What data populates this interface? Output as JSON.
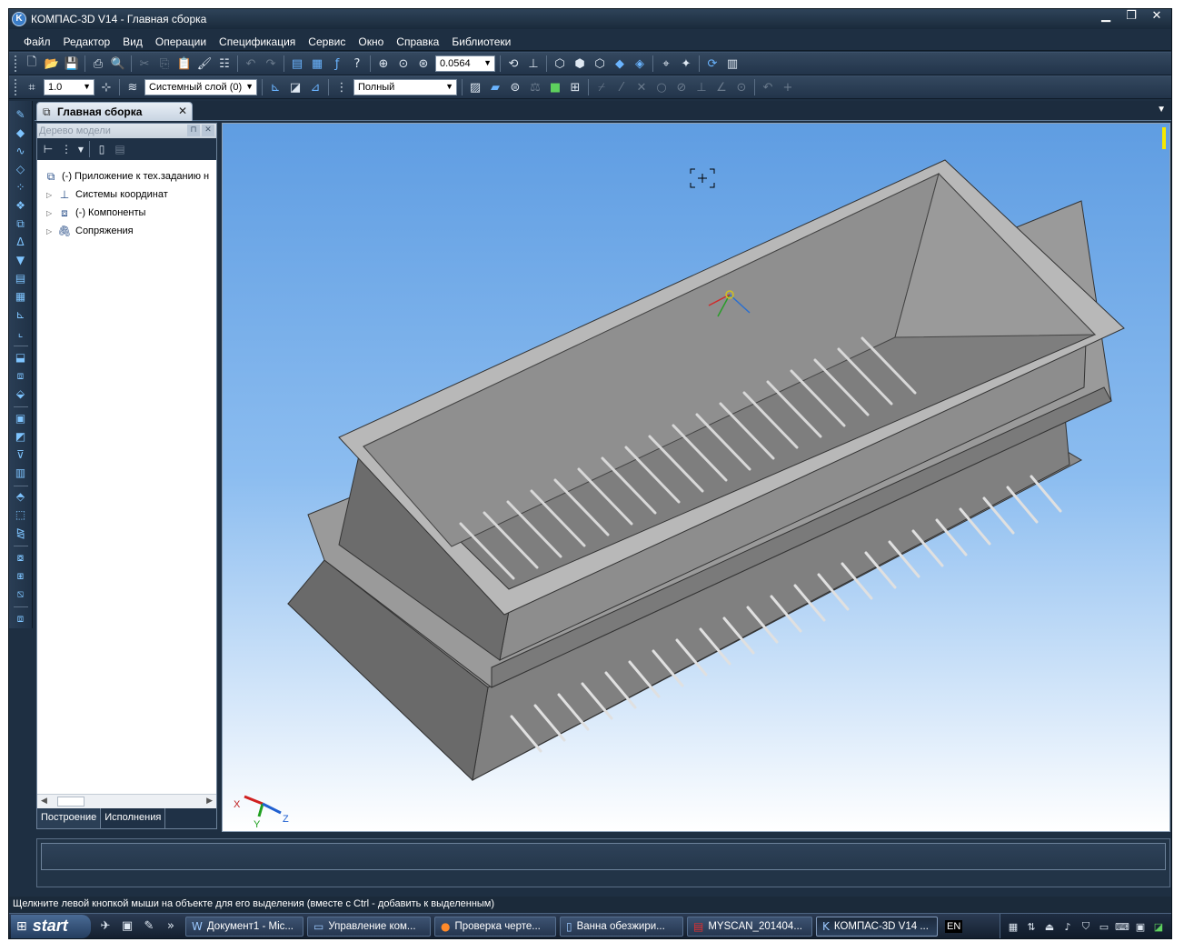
{
  "window": {
    "title": "КОМПАС-3D V14 - Главная сборка",
    "logo_letter": "K",
    "controls": {
      "minimize": "▁",
      "restore": "❐",
      "close": "✕"
    }
  },
  "menu": [
    "Файл",
    "Редактор",
    "Вид",
    "Операции",
    "Спецификация",
    "Сервис",
    "Окно",
    "Справка",
    "Библиотеки"
  ],
  "toolbar_main": {
    "zoom_value": "0.0564"
  },
  "toolbar_current": {
    "step_value": "1.0",
    "layer_value": "Системный слой (0)",
    "view_mode_value": "Полный"
  },
  "document_tab": {
    "label": "Главная сборка",
    "close": "✕"
  },
  "model_tree": {
    "header": "Дерево модели",
    "items": [
      {
        "label": "(-) Приложение к тех.заданию н"
      },
      {
        "label": "Системы координат"
      },
      {
        "label": "(-) Компоненты"
      },
      {
        "label": "Сопряжения"
      }
    ],
    "tabs": [
      "Построение",
      "Исполнения"
    ]
  },
  "viewport": {
    "axis_x": "X",
    "axis_y": "Y",
    "axis_z": "Z"
  },
  "status": {
    "hint": "Щелкните левой кнопкой мыши на объекте для его выделения (вместе с Ctrl - добавить к выделенным)"
  },
  "taskbar": {
    "start_label": "start",
    "overflow": "»",
    "tasks": [
      {
        "label": "Документ1 - Mic..."
      },
      {
        "label": "Управление ком..."
      },
      {
        "label": "Проверка черте..."
      },
      {
        "label": "Ванна обезжири..."
      },
      {
        "label": "MYSCAN_201404..."
      },
      {
        "label": "КОМПАС-3D V14 ..."
      }
    ],
    "lang": "EN"
  },
  "colors": {
    "accent": "#3a7dc8",
    "sky_top": "#5f9de2",
    "sky_bottom": "#ffffff",
    "model_face": "#8d8d8d",
    "model_dark": "#5c5c5c",
    "model_light": "#c6c6c6"
  }
}
